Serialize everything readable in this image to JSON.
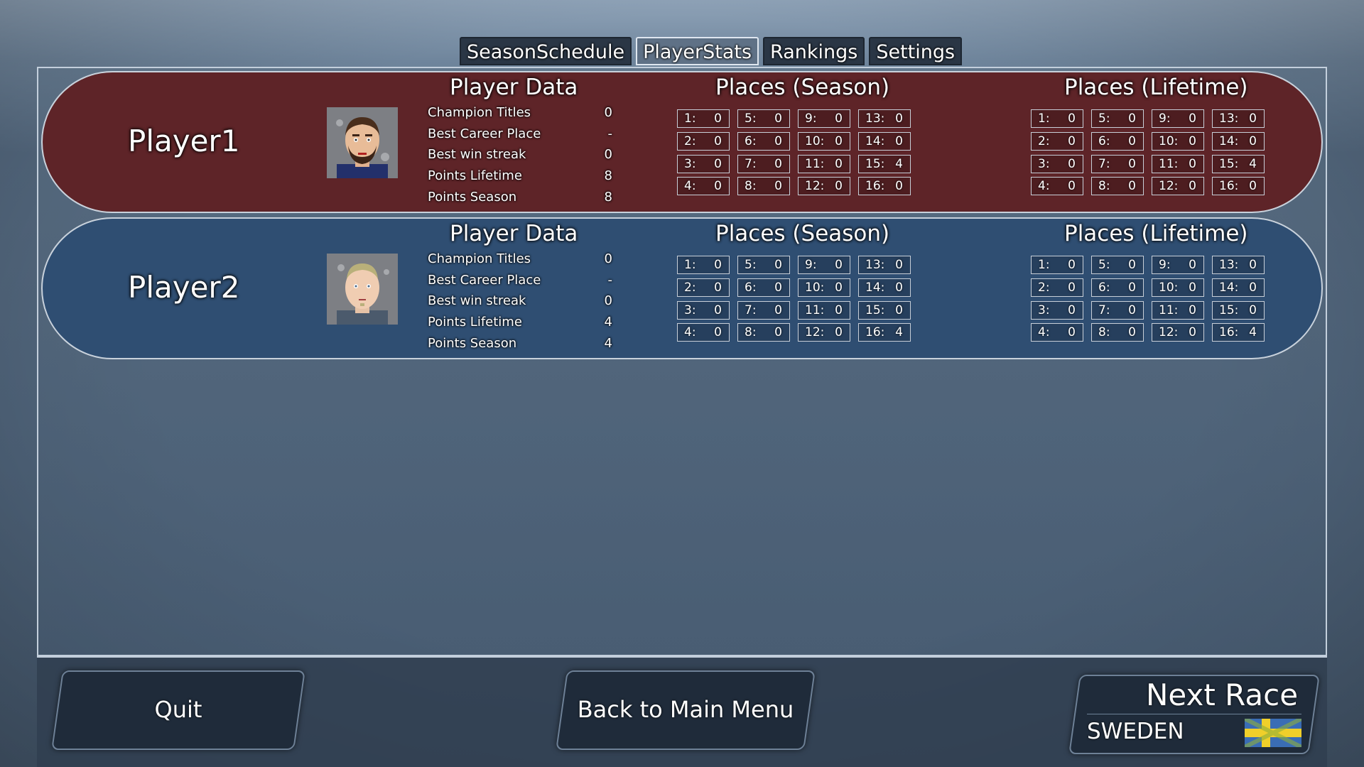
{
  "tabs": [
    {
      "label": "SeasonSchedule",
      "active": false
    },
    {
      "label": "PlayerStats",
      "active": true
    },
    {
      "label": "Rankings",
      "active": false
    },
    {
      "label": "Settings",
      "active": false
    }
  ],
  "section_titles": {
    "player_data": "Player Data",
    "places_season": "Places (Season)",
    "places_lifetime": "Places (Lifetime)"
  },
  "players": [
    {
      "name": "Player1",
      "row_color": "#5e2428",
      "stats": [
        {
          "label": "Champion Titles",
          "value": "0"
        },
        {
          "label": "Best Career Place",
          "value": "-"
        },
        {
          "label": "Best win streak",
          "value": "0"
        },
        {
          "label": "Points Lifetime",
          "value": "8"
        },
        {
          "label": "Points Season",
          "value": "8"
        }
      ],
      "season": [
        {
          "place": "1:",
          "count": "0"
        },
        {
          "place": "2:",
          "count": "0"
        },
        {
          "place": "3:",
          "count": "0"
        },
        {
          "place": "4:",
          "count": "0"
        },
        {
          "place": "5:",
          "count": "0"
        },
        {
          "place": "6:",
          "count": "0"
        },
        {
          "place": "7:",
          "count": "0"
        },
        {
          "place": "8:",
          "count": "0"
        },
        {
          "place": "9:",
          "count": "0"
        },
        {
          "place": "10:",
          "count": "0"
        },
        {
          "place": "11:",
          "count": "0"
        },
        {
          "place": "12:",
          "count": "0"
        },
        {
          "place": "13:",
          "count": "0"
        },
        {
          "place": "14:",
          "count": "0"
        },
        {
          "place": "15:",
          "count": "4"
        },
        {
          "place": "16:",
          "count": "0"
        }
      ],
      "lifetime": [
        {
          "place": "1:",
          "count": "0"
        },
        {
          "place": "2:",
          "count": "0"
        },
        {
          "place": "3:",
          "count": "0"
        },
        {
          "place": "4:",
          "count": "0"
        },
        {
          "place": "5:",
          "count": "0"
        },
        {
          "place": "6:",
          "count": "0"
        },
        {
          "place": "7:",
          "count": "0"
        },
        {
          "place": "8:",
          "count": "0"
        },
        {
          "place": "9:",
          "count": "0"
        },
        {
          "place": "10:",
          "count": "0"
        },
        {
          "place": "11:",
          "count": "0"
        },
        {
          "place": "12:",
          "count": "0"
        },
        {
          "place": "13:",
          "count": "0"
        },
        {
          "place": "14:",
          "count": "0"
        },
        {
          "place": "15:",
          "count": "4"
        },
        {
          "place": "16:",
          "count": "0"
        }
      ]
    },
    {
      "name": "Player2",
      "row_color": "#2f4e72",
      "stats": [
        {
          "label": "Champion Titles",
          "value": "0"
        },
        {
          "label": "Best Career Place",
          "value": "-"
        },
        {
          "label": "Best win streak",
          "value": "0"
        },
        {
          "label": "Points Lifetime",
          "value": "4"
        },
        {
          "label": "Points Season",
          "value": "4"
        }
      ],
      "season": [
        {
          "place": "1:",
          "count": "0"
        },
        {
          "place": "2:",
          "count": "0"
        },
        {
          "place": "3:",
          "count": "0"
        },
        {
          "place": "4:",
          "count": "0"
        },
        {
          "place": "5:",
          "count": "0"
        },
        {
          "place": "6:",
          "count": "0"
        },
        {
          "place": "7:",
          "count": "0"
        },
        {
          "place": "8:",
          "count": "0"
        },
        {
          "place": "9:",
          "count": "0"
        },
        {
          "place": "10:",
          "count": "0"
        },
        {
          "place": "11:",
          "count": "0"
        },
        {
          "place": "12:",
          "count": "0"
        },
        {
          "place": "13:",
          "count": "0"
        },
        {
          "place": "14:",
          "count": "0"
        },
        {
          "place": "15:",
          "count": "0"
        },
        {
          "place": "16:",
          "count": "4"
        }
      ],
      "lifetime": [
        {
          "place": "1:",
          "count": "0"
        },
        {
          "place": "2:",
          "count": "0"
        },
        {
          "place": "3:",
          "count": "0"
        },
        {
          "place": "4:",
          "count": "0"
        },
        {
          "place": "5:",
          "count": "0"
        },
        {
          "place": "6:",
          "count": "0"
        },
        {
          "place": "7:",
          "count": "0"
        },
        {
          "place": "8:",
          "count": "0"
        },
        {
          "place": "9:",
          "count": "0"
        },
        {
          "place": "10:",
          "count": "0"
        },
        {
          "place": "11:",
          "count": "0"
        },
        {
          "place": "12:",
          "count": "0"
        },
        {
          "place": "13:",
          "count": "0"
        },
        {
          "place": "14:",
          "count": "0"
        },
        {
          "place": "15:",
          "count": "0"
        },
        {
          "place": "16:",
          "count": "4"
        }
      ]
    }
  ],
  "buttons": {
    "quit": "Quit",
    "back": "Back to Main Menu",
    "next_race": "Next Race",
    "next_country": "SWEDEN"
  },
  "icons": {
    "player1_avatar": "avatar-dark-hair-beard-icon",
    "player2_avatar": "avatar-blond-icon",
    "next_flag": "sweden-flag-icon"
  }
}
